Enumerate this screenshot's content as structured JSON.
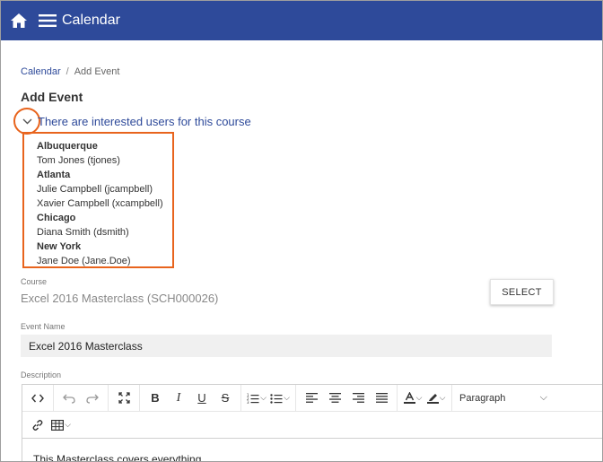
{
  "header": {
    "title": "Calendar",
    "home_icon": "home-icon",
    "menu_icon": "menu-icon",
    "bg_color": "#2e4a9a"
  },
  "breadcrumb": {
    "link": "Calendar",
    "separator": "/",
    "current": "Add Event"
  },
  "page_title": "Add Event",
  "interested": {
    "text": "There are interested users for this course",
    "highlight_color": "#e8641d",
    "rows": [
      {
        "text": "Albuquerque",
        "city": true
      },
      {
        "text": "Tom Jones (tjones)",
        "city": false
      },
      {
        "text": "Atlanta",
        "city": true
      },
      {
        "text": "Julie Campbell (jcampbell)",
        "city": false
      },
      {
        "text": "Xavier Campbell (xcampbell)",
        "city": false
      },
      {
        "text": "Chicago",
        "city": true
      },
      {
        "text": "Diana Smith (dsmith)",
        "city": false
      },
      {
        "text": "New York",
        "city": true
      },
      {
        "text": "Jane Doe (Jane.Doe)",
        "city": false
      }
    ]
  },
  "course": {
    "label": "Course",
    "value": "Excel 2016 Masterclass (SCH000026)",
    "select_label": "SELECT"
  },
  "event_name": {
    "label": "Event Name",
    "value": "Excel 2016 Masterclass"
  },
  "description": {
    "label": "Description",
    "paragraph_format": "Paragraph",
    "content_preview": "This Masterclass covers everything"
  }
}
